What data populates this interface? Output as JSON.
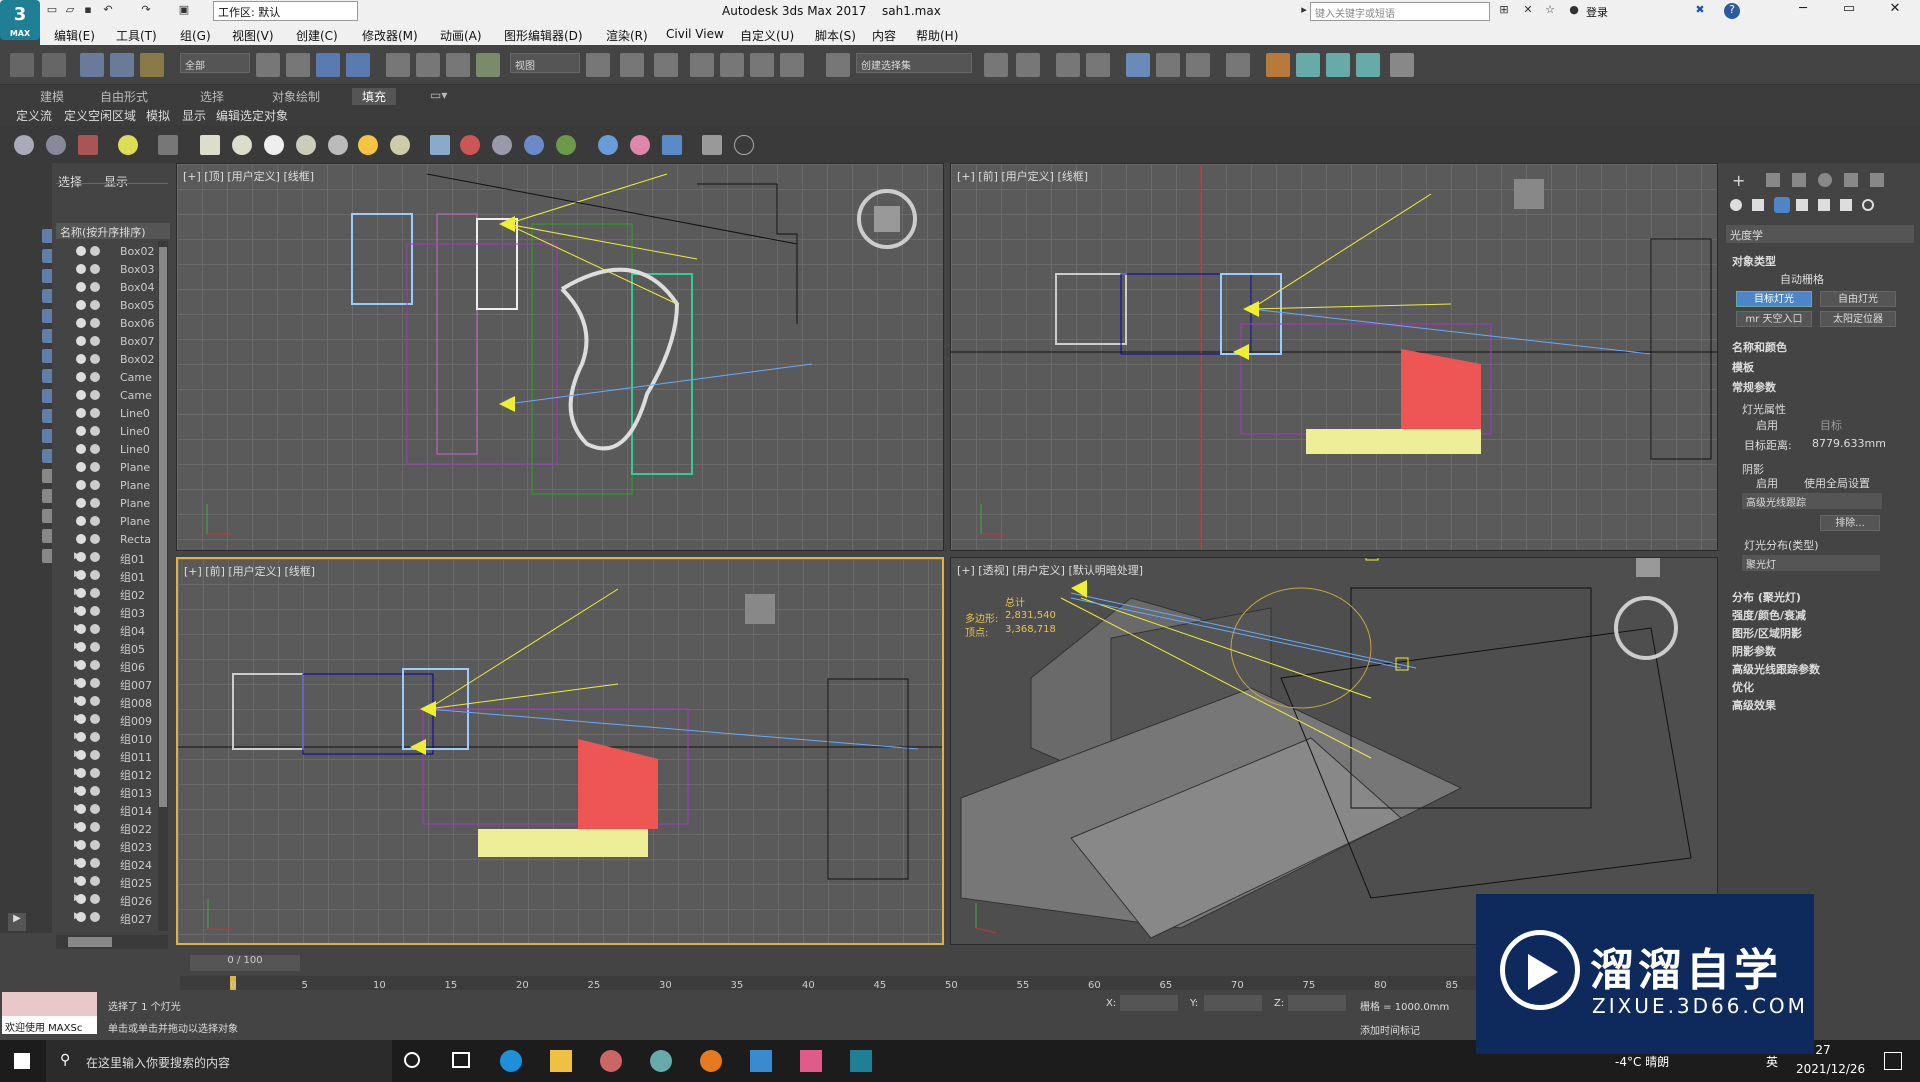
{
  "app": {
    "logo_text": "3",
    "logo_sub": "MAX",
    "title": "Autodesk 3ds Max 2017",
    "file": "sah1.max",
    "workspace": "工作区: 默认",
    "search_placeholder": "键入关键字或短语",
    "login": "登录"
  },
  "menu": [
    "编辑(E)",
    "工具(T)",
    "组(G)",
    "视图(V)",
    "创建(C)",
    "修改器(M)",
    "动画(A)",
    "图形编辑器(D)",
    "渲染(R)",
    "Civil View",
    "自定义(U)",
    "脚本(S)",
    "内容",
    "帮助(H)"
  ],
  "toolbar": {
    "filter": "全部",
    "refcoord": "视图",
    "selset": "创建选择集"
  },
  "ribbon": {
    "tabs": [
      "建模",
      "自由形式",
      "选择",
      "对象绘制",
      "填充"
    ],
    "active": "填充",
    "subs": [
      "定义流",
      "定义空闲区域",
      "模拟",
      "显示",
      "编辑选定对象"
    ]
  },
  "explorer": {
    "tabs": [
      "选择",
      "显示"
    ],
    "header": "名称(按升序排序)",
    "items": [
      "Box02",
      "Box03",
      "Box04",
      "Box05",
      "Box06",
      "Box07",
      "Box02",
      "Came",
      "Came",
      "Line0",
      "Line0",
      "Line0",
      "Plane",
      "Plane",
      "Plane",
      "Plane",
      "Recta",
      "组01",
      "组01",
      "组02",
      "组03",
      "组04",
      "组05",
      "组06",
      "组007",
      "组008",
      "组009",
      "组010",
      "组011",
      "组012",
      "组013",
      "组014",
      "组022",
      "组023",
      "组024",
      "组025",
      "组026",
      "组027"
    ]
  },
  "viewports": [
    {
      "label": "[+] [顶] [用户定义] [线框]"
    },
    {
      "label": "[+] [前] [用户定义] [线框]"
    },
    {
      "label": "[+] [前] [用户定义] [线框]"
    },
    {
      "label": "[+] [透视] [用户定义] [默认明暗处理]",
      "stats": {
        "title": "总计",
        "poly_label": "多边形:",
        "poly": "2,831,540",
        "vert_label": "顶点:",
        "vert": "3,368,718"
      }
    }
  ],
  "panel": {
    "category": "光度学",
    "object_type": "对象类型",
    "autogrid": "自动栅格",
    "btn_target": "目标灯光",
    "btn_free": "自由灯光",
    "btn_sky": "mr 天空入口",
    "btn_sun": "太阳定位器",
    "name_color": "名称和颜色",
    "template": "模板",
    "general": "常规参数",
    "light_props": "灯光属性",
    "enable": "启用",
    "target": "目标",
    "target_dist_label": "目标距离:",
    "target_dist": "8779.633mm",
    "shadows": "阴影",
    "shadow_on": "启用",
    "global": "使用全局设置",
    "shadow_type": "高级光线跟踪",
    "exclude": "排除...",
    "dist_label": "灯光分布(类型)",
    "dist": "聚光灯",
    "rollouts": [
      "分布 (聚光灯)",
      "强度/颜色/衰减",
      "图形/区域阴影",
      "阴影参数",
      "高级光线跟踪参数",
      "优化",
      "高级效果"
    ]
  },
  "timeline": {
    "counter": "0 / 100",
    "ticks": [
      "0",
      "5",
      "10",
      "15",
      "20",
      "25",
      "30",
      "35",
      "40",
      "45",
      "50",
      "55",
      "60",
      "65",
      "70",
      "75",
      "80",
      "85"
    ]
  },
  "status": {
    "selected": "选择了 1 个灯光",
    "hint": "单击或单击并拖动以选择对象",
    "welcome": "欢迎使用 MAXSc",
    "x": "X:",
    "y": "Y:",
    "z": "Z:",
    "grid": "栅格 = 1000.0mm",
    "addtime": "添加时间标记"
  },
  "taskbar": {
    "search": "在这里输入你要搜索的内容",
    "weather": "-4°C 晴朗",
    "lang": "英",
    "time": "21:27",
    "date": "2021/12/26"
  },
  "watermark": {
    "title": "溜溜自学",
    "url": "ZIXUE.3D66.COM"
  }
}
